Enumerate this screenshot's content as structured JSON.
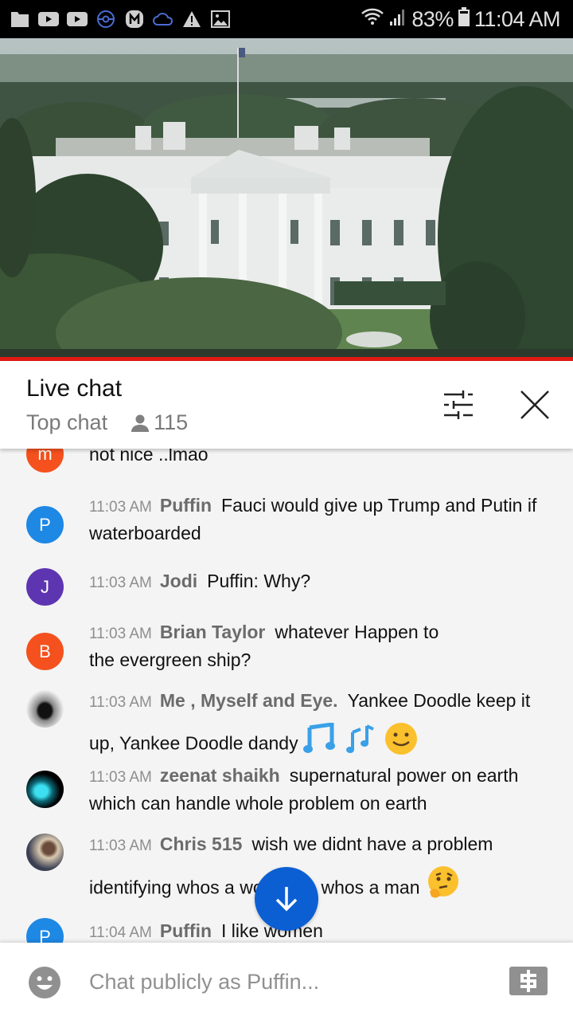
{
  "status_bar": {
    "notification_icons": [
      "folder-icon",
      "youtube-icon",
      "youtube-icon",
      "pokeball-icon",
      "m-app-icon",
      "cloud-icon",
      "warning-icon",
      "image-icon"
    ],
    "battery": "83%",
    "time": "11:04 AM"
  },
  "video": {
    "description": "Live stream of the White House north facade"
  },
  "chat_header": {
    "title": "Live chat",
    "mode": "Top chat",
    "viewer_count": "115"
  },
  "messages": [
    {
      "avatar_letter": "m",
      "avatar_color": "#f4511e",
      "time": "",
      "author": "",
      "text": "not nice ..lmao"
    },
    {
      "avatar_letter": "P",
      "avatar_color": "#1e88e5",
      "time": "11:03 AM",
      "author": "Puffin",
      "text": "Fauci would give up Trump and Putin if waterboarded"
    },
    {
      "avatar_letter": "J",
      "avatar_color": "#5e35b1",
      "time": "11:03 AM",
      "author": "Jodi",
      "text": "Puffin: Why?"
    },
    {
      "avatar_letter": "B",
      "avatar_color": "#f4511e",
      "time": "11:03 AM",
      "author": "Brian Taylor",
      "text": "whatever Happen to the evergreen ship?"
    },
    {
      "avatar_letter": "",
      "avatar_color": "#cccccc",
      "time": "11:03 AM",
      "author": "Me , Myself and Eye.",
      "text": "Yankee Doodle keep it up, Yankee Doodle dandy",
      "emojis": [
        "musical-note-emoji",
        "musical-notes-emoji",
        "slightly-smiling-face-emoji"
      ]
    },
    {
      "avatar_letter": "",
      "avatar_color": "#000000",
      "time": "11:03 AM",
      "author": "zeenat shaikh",
      "text": "supernatural power on earth which can handle whole problem on earth"
    },
    {
      "avatar_letter": "",
      "avatar_color": "#b9a48a",
      "time": "11:03 AM",
      "author": "Chris 515",
      "text": "wish we didnt have a problem identifying whos a woman & whos a man",
      "emojis": [
        "thinking-face-emoji"
      ]
    },
    {
      "avatar_letter": "P",
      "avatar_color": "#1e88e5",
      "time": "11:04 AM",
      "author": "Puffin",
      "text": "I like women"
    }
  ],
  "input": {
    "placeholder": "Chat publicly as Puffin..."
  },
  "colors": {
    "accent_red": "#e01a14",
    "fab_blue": "#0b5fd3"
  }
}
